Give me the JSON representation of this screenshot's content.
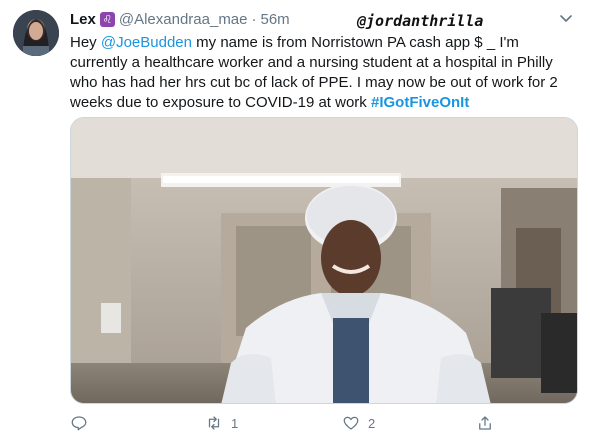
{
  "tweet": {
    "author_name": "Lex",
    "badge_icon": "leo-zodiac-icon",
    "handle": "@Alexandraa_mae",
    "separator": "·",
    "time": "56m",
    "watermark": "@jordanthrilla",
    "text_parts": {
      "p1": "Hey ",
      "mention": "@JoeBudden",
      "p2": " my name is        from Norristown PA cash app $  _  I'm currently a healthcare worker and a nursing student at a hospital in Philly who has had her hrs cut bc of lack of PPE. I may now be out of work for 2 weeks due to exposure to COVID-19 at work ",
      "hashtag": "#IGotFiveOnIt"
    },
    "media_description_icon": "photo-healthcare-worker-in-ppe",
    "actions": {
      "reply_count": "",
      "retweet_count": "1",
      "like_count": "2",
      "share_label": ""
    },
    "colors": {
      "link": "#1b95e0",
      "muted": "#657786",
      "badge": "#8e44ad"
    }
  }
}
